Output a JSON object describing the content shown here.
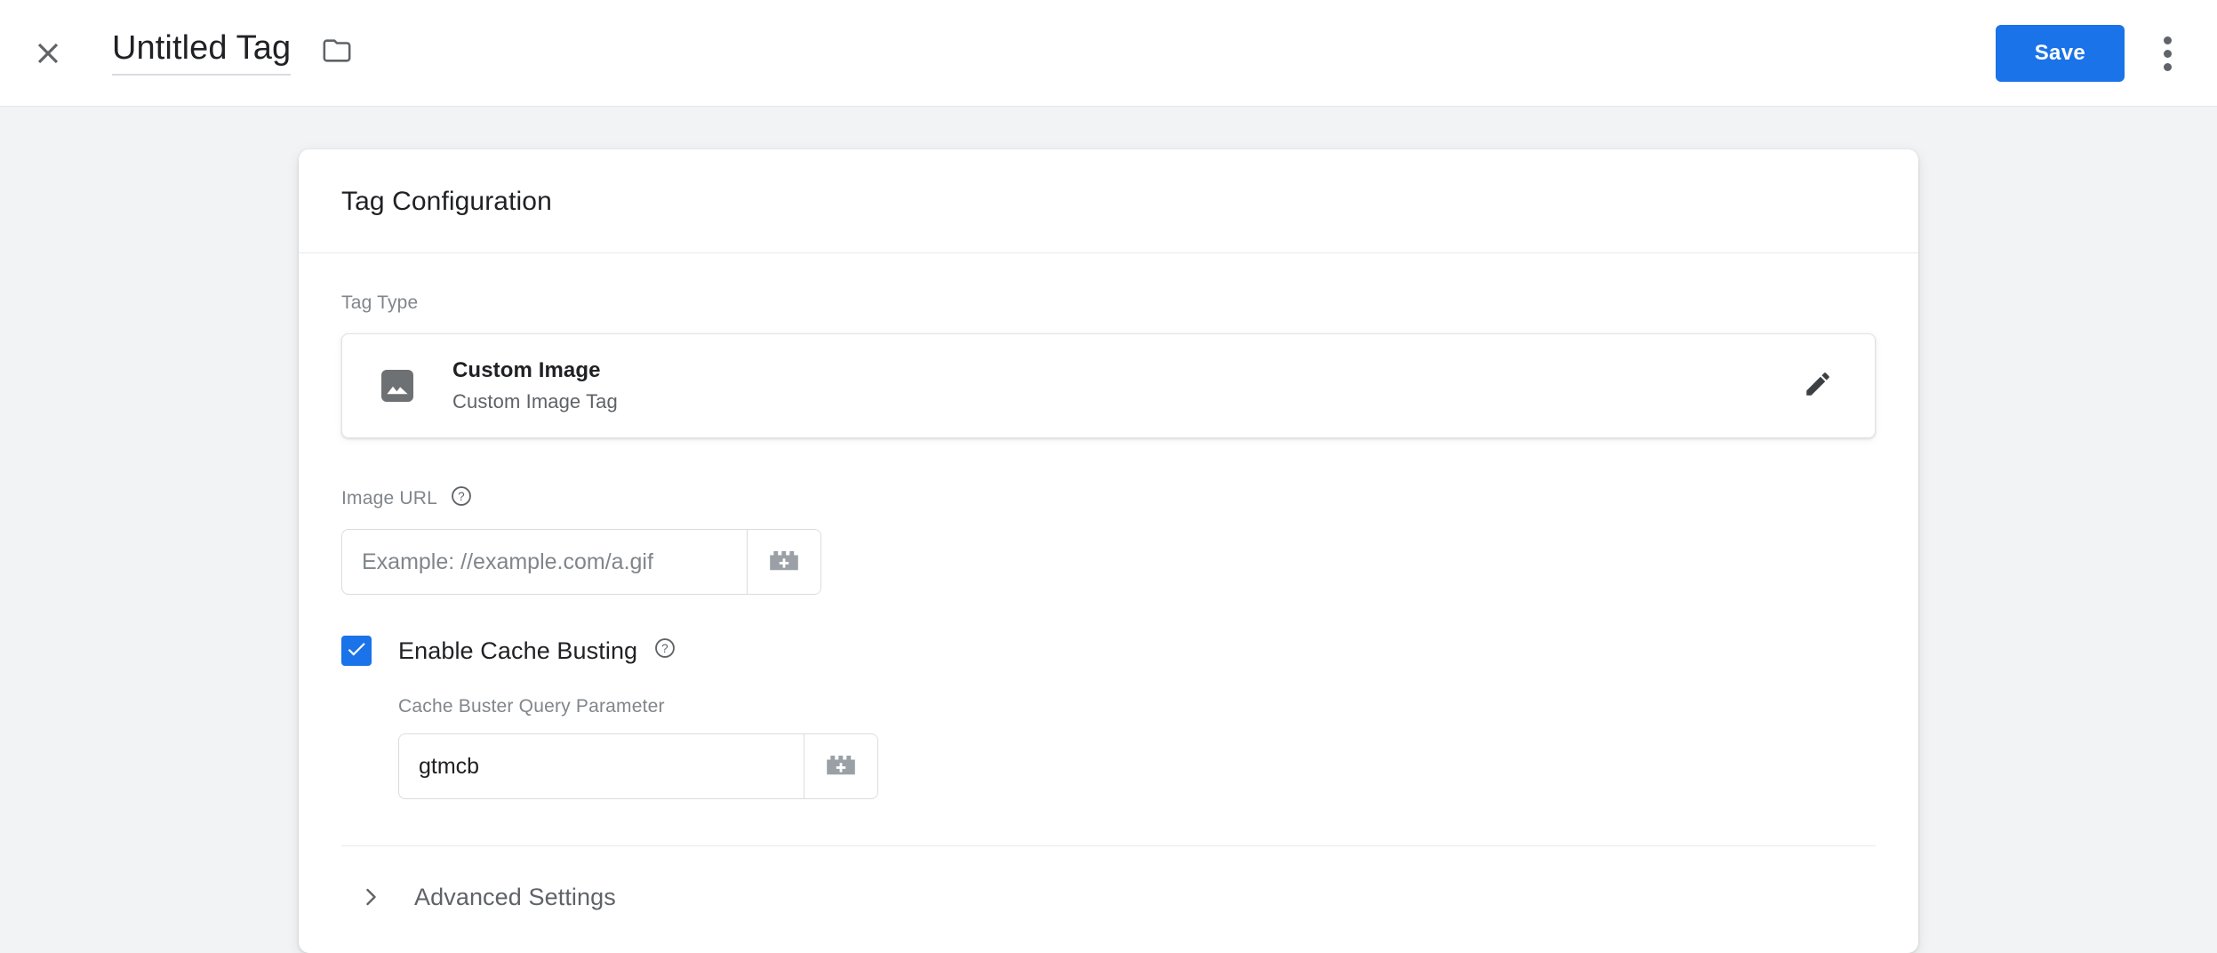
{
  "header": {
    "close_icon": "close-icon",
    "title": "Untitled Tag",
    "folder_icon": "folder-icon",
    "save_label": "Save",
    "more_icon": "more-vert-icon"
  },
  "card": {
    "title": "Tag Configuration",
    "tag_type": {
      "label": "Tag Type",
      "icon": "image-icon",
      "name": "Custom Image",
      "description": "Custom Image Tag",
      "edit_icon": "pencil-icon"
    },
    "image_url": {
      "label": "Image URL",
      "help_icon": "help-circle-icon",
      "value": "",
      "placeholder": "Example: //example.com/a.gif",
      "variable_icon": "insert-variable-icon"
    },
    "cache_busting": {
      "checked": true,
      "label": "Enable Cache Busting",
      "help_icon": "help-circle-icon",
      "param_label": "Cache Buster Query Parameter",
      "param_value": "gtmcb",
      "param_placeholder": "",
      "variable_icon": "insert-variable-icon"
    },
    "advanced": {
      "label": "Advanced Settings",
      "chevron_icon": "chevron-right-icon",
      "expanded": false
    }
  },
  "colors": {
    "accent": "#1a73e8",
    "page_bg": "#f1f3f4",
    "card_bg": "#ffffff",
    "text_primary": "#202124",
    "text_secondary": "#5f6368",
    "text_muted": "#80868b",
    "border": "#dadce0"
  }
}
